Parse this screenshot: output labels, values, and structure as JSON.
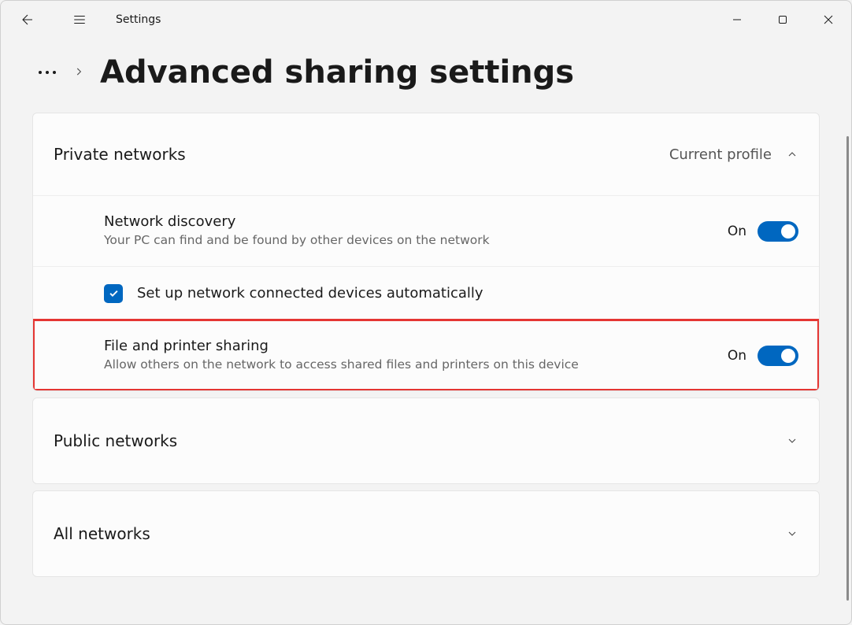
{
  "appTitle": "Settings",
  "pageTitle": "Advanced sharing settings",
  "sections": {
    "private": {
      "title": "Private networks",
      "badge": "Current profile",
      "settings": {
        "discovery": {
          "title": "Network discovery",
          "desc": "Your PC can find and be found by other devices on the network",
          "state": "On"
        },
        "autosetup": {
          "label": "Set up network connected devices automatically"
        },
        "filePrinter": {
          "title": "File and printer sharing",
          "desc": "Allow others on the network to access shared files and printers on this device",
          "state": "On"
        }
      }
    },
    "public": {
      "title": "Public networks"
    },
    "all": {
      "title": "All networks"
    }
  }
}
